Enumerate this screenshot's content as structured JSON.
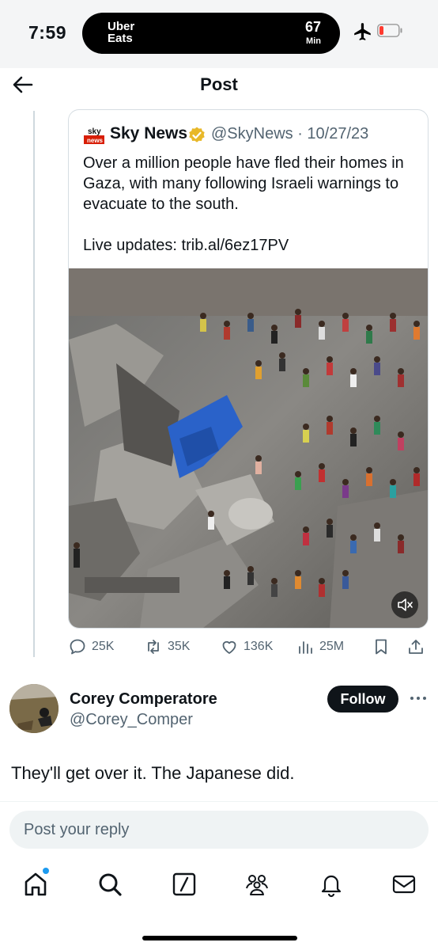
{
  "status_bar": {
    "time": "7:59",
    "activity_line1": "Uber",
    "activity_line2": "Eats",
    "eta_value": "67",
    "eta_unit": "Min"
  },
  "header": {
    "title": "Post"
  },
  "quoted_post": {
    "author_name": "Sky News",
    "logo_top": "sky",
    "logo_bottom": "news",
    "handle_date": "@SkyNews · 10/27/23",
    "text": "Over a million people have fled their homes in Gaza, with many following Israeli warnings to evacuate to the south.\n\nLive updates: trib.al/6ez17PV",
    "image_icon": "crowd-rubble-photo",
    "mute_icon": "speaker-muted-icon"
  },
  "actions": {
    "replies": "25K",
    "reposts": "35K",
    "likes": "136K",
    "views": "25M"
  },
  "reply": {
    "author_name": "Corey Comperatore",
    "handle": "@Corey_Comper",
    "follow_label": "Follow",
    "text": "They'll get over it. The Japanese did."
  },
  "composer": {
    "placeholder": "Post your reply"
  },
  "colors": {
    "accent": "#1d9bf0",
    "text": "#0f1419",
    "muted": "#536471",
    "verified_gold": "#e8b829",
    "sky_red": "#d81e05"
  }
}
